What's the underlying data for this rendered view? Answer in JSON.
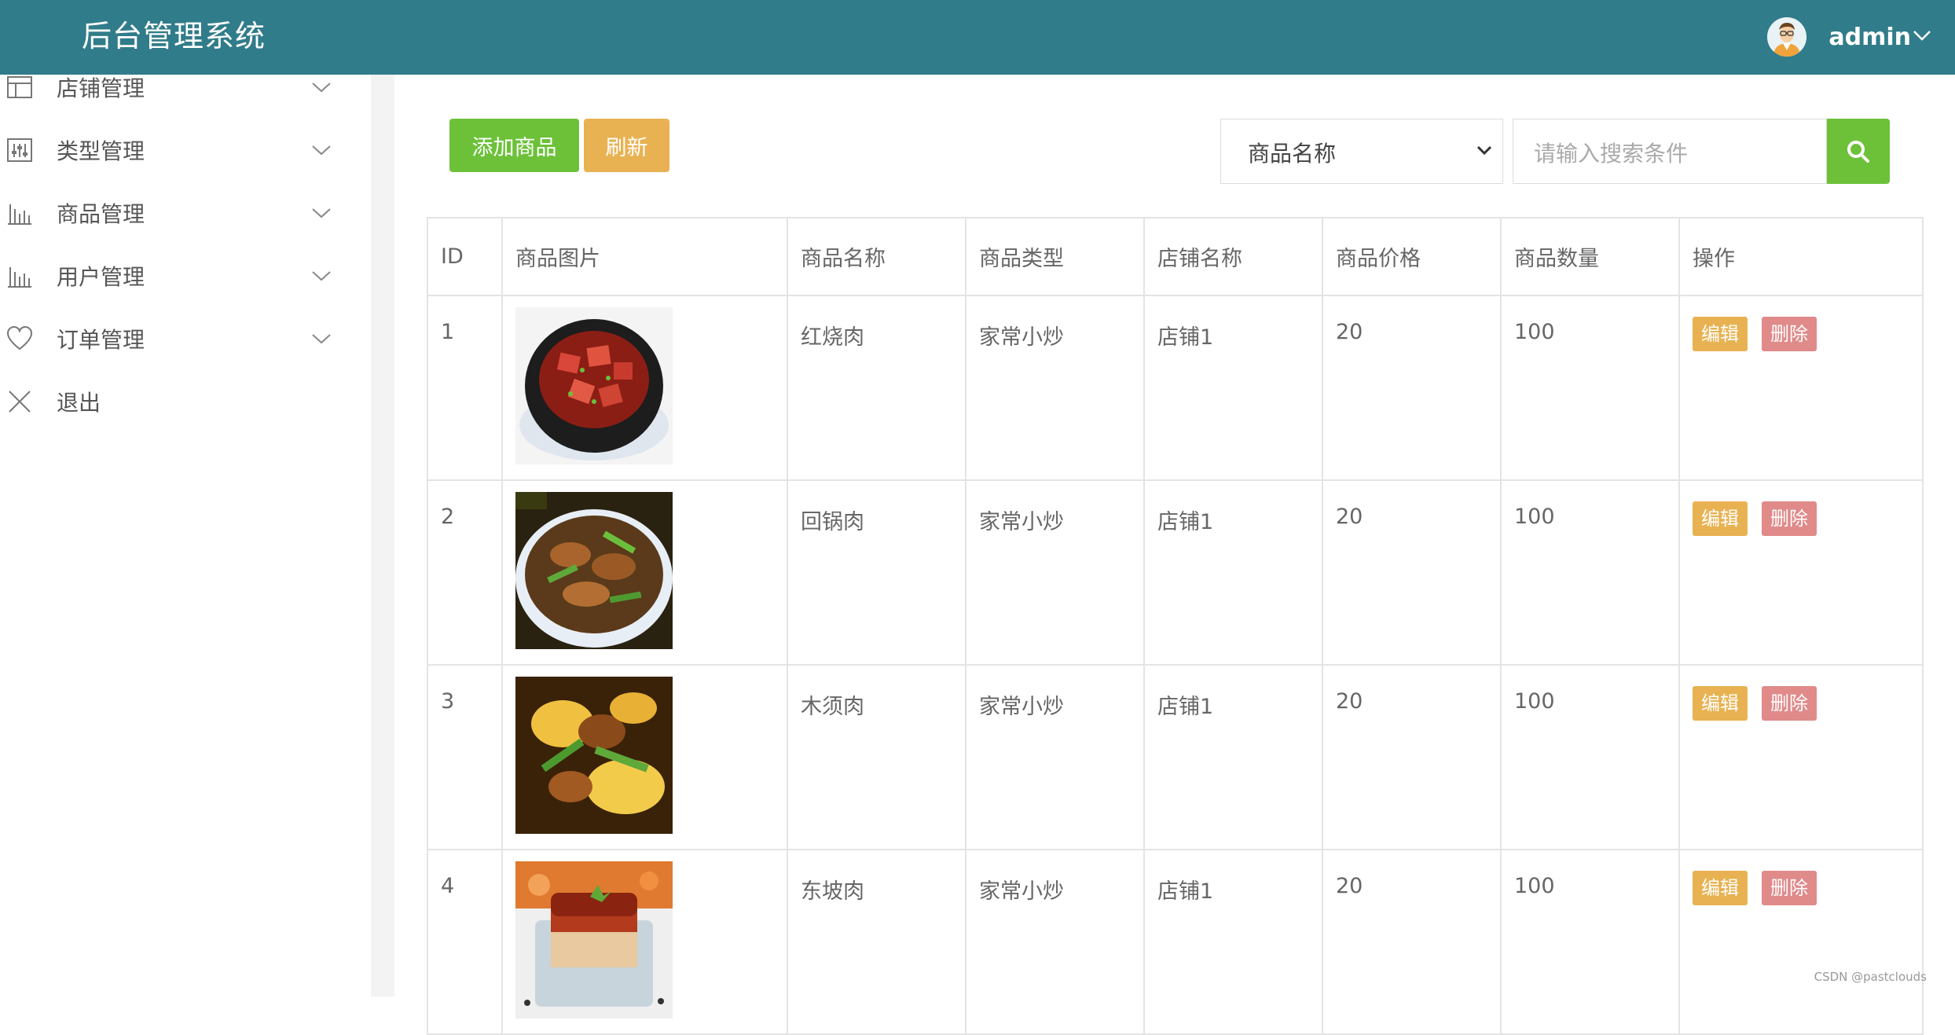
{
  "header": {
    "title": "后台管理系统",
    "username": "admin",
    "colors": {
      "bar": "#317c8a"
    }
  },
  "sidebar": {
    "items": [
      {
        "label": "店铺管理",
        "icon": "layout-icon"
      },
      {
        "label": "类型管理",
        "icon": "sliders-icon"
      },
      {
        "label": "商品管理",
        "icon": "bar-chart-icon"
      },
      {
        "label": "用户管理",
        "icon": "bar-chart-icon"
      },
      {
        "label": "订单管理",
        "icon": "heart-icon"
      },
      {
        "label": "退出",
        "icon": "close-icon"
      }
    ]
  },
  "toolbar": {
    "add_label": "添加商品",
    "refresh_label": "刷新",
    "search_field_selected": "商品名称",
    "search_placeholder": "请输入搜索条件"
  },
  "table": {
    "headers": [
      "ID",
      "商品图片",
      "商品名称",
      "商品类型",
      "店铺名称",
      "商品价格",
      "商品数量",
      "操作"
    ],
    "rows": [
      {
        "id": "1",
        "name": "红烧肉",
        "type": "家常小炒",
        "shop": "店铺1",
        "price": "20",
        "qty": "100",
        "edit": "编辑",
        "del": "删除"
      },
      {
        "id": "2",
        "name": "回锅肉",
        "type": "家常小炒",
        "shop": "店铺1",
        "price": "20",
        "qty": "100",
        "edit": "编辑",
        "del": "删除"
      },
      {
        "id": "3",
        "name": "木须肉",
        "type": "家常小炒",
        "shop": "店铺1",
        "price": "20",
        "qty": "100",
        "edit": "编辑",
        "del": "删除"
      },
      {
        "id": "4",
        "name": "东坡肉",
        "type": "家常小炒",
        "shop": "店铺1",
        "price": "20",
        "qty": "100",
        "edit": "编辑",
        "del": "删除"
      }
    ]
  },
  "watermark": "CSDN @pastclouds",
  "colors": {
    "green": "#6cc139",
    "orange": "#e8b252",
    "red": "#e08a8a"
  }
}
